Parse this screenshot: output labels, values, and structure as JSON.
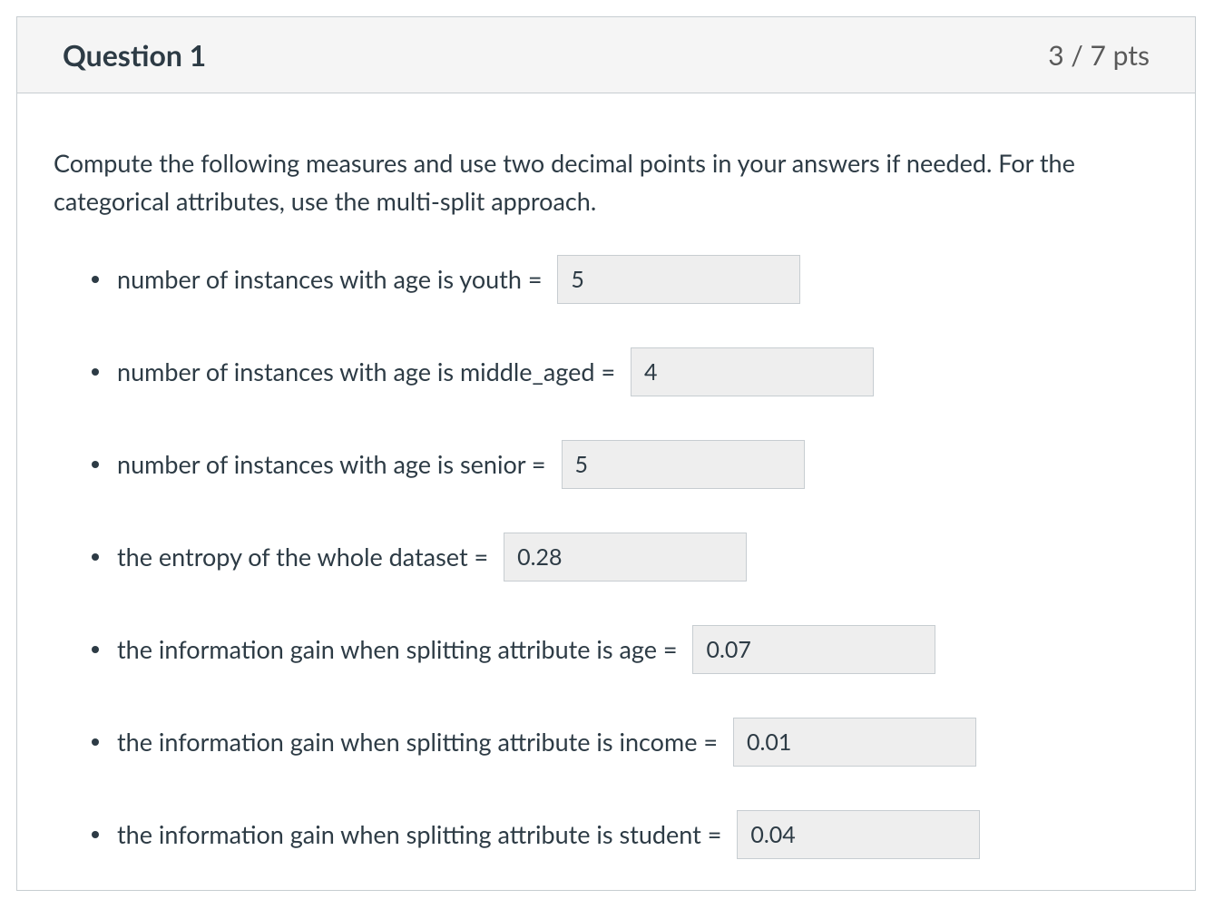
{
  "header": {
    "title": "Question 1",
    "points": "3 / 7 pts"
  },
  "instructions": "Compute the following measures and use two decimal points in your answers if needed. For the categorical attributes, use the multi-split approach.",
  "items": [
    {
      "label": "number of instances with age is youth = ",
      "value": "5"
    },
    {
      "label": "number of instances with age is middle_aged = ",
      "value": "4"
    },
    {
      "label": "number of instances with age is senior = ",
      "value": "5"
    },
    {
      "label": "the entropy of the whole dataset = ",
      "value": "0.28"
    },
    {
      "label": "the information gain when splitting attribute is age = ",
      "value": "0.07"
    },
    {
      "label": "the information gain when splitting attribute is income = ",
      "value": "0.01"
    },
    {
      "label": "the information gain when splitting attribute is student = ",
      "value": "0.04"
    }
  ]
}
